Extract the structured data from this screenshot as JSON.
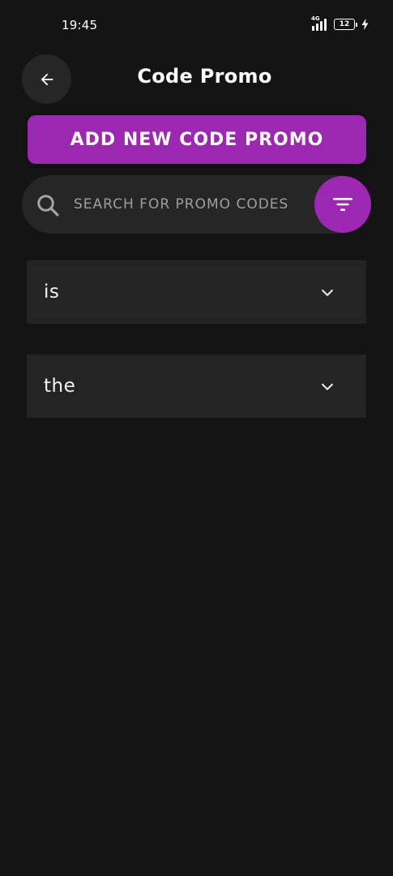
{
  "status_bar": {
    "time": "19:45",
    "network": "4G",
    "battery_level": "12"
  },
  "header": {
    "title": "Code Promo",
    "back_icon": "arrow-left-icon"
  },
  "actions": {
    "add_label": "ADD NEW CODE PROMO"
  },
  "search": {
    "placeholder": "SEARCH FOR PROMO CODES",
    "value": "",
    "icon": "search-icon",
    "filter_icon": "filter-icon"
  },
  "promo_list": [
    {
      "label": "is"
    },
    {
      "label": "the"
    }
  ],
  "colors": {
    "background": "#141414",
    "accent": "#9c27b0",
    "surface": "#262626",
    "card": "#242424"
  }
}
